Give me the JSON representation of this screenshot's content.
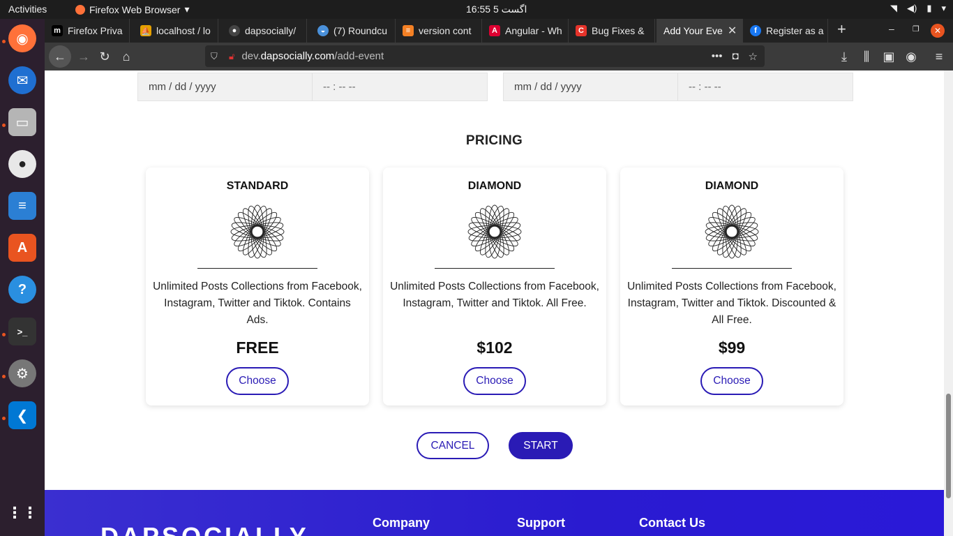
{
  "system": {
    "activities": "Activities",
    "app_name": "Firefox Web Browser",
    "clock": "16:55  اگست 5"
  },
  "tabs": [
    {
      "label": "Firefox Priva",
      "icon": "firefox-private-icon",
      "color": "#000000"
    },
    {
      "label": "localhost / lo",
      "icon": "phpmyadmin-icon",
      "color": "#e5a000"
    },
    {
      "label": "dapsocially/",
      "icon": "github-icon",
      "color": "#222222"
    },
    {
      "label": "(7) Roundcu",
      "icon": "roundcube-icon",
      "color": "#4a90d9"
    },
    {
      "label": "version cont",
      "icon": "stackoverflow-icon",
      "color": "#f48024"
    },
    {
      "label": "Angular - Wh",
      "icon": "angular-icon",
      "color": "#dd0031"
    },
    {
      "label": "Bug Fixes & ",
      "icon": "clickup-icon",
      "color": "#e6332a"
    },
    {
      "label": "Add Your Eve",
      "icon": "",
      "color": "",
      "active": true
    },
    {
      "label": "Register as a",
      "icon": "facebook-icon",
      "color": "#1877f2"
    }
  ],
  "url": {
    "prefix": "dev.",
    "domain": "dapsocially.com",
    "path": "/add-event"
  },
  "datetime": {
    "date_placeholder": "mm / dd / yyyy",
    "time_placeholder": "-- : --  --"
  },
  "pricing": {
    "title": "PRICING",
    "plans": [
      {
        "name": "STANDARD",
        "desc": "Unlimited Posts Collections from Facebook, Instagram, Twitter and Tiktok. Contains Ads.",
        "price": "FREE",
        "button": "Choose"
      },
      {
        "name": "DIAMOND",
        "desc": "Unlimited Posts Collections from Facebook, Instagram, Twitter and Tiktok. All Free.",
        "price": "$102",
        "button": "Choose"
      },
      {
        "name": "DIAMOND",
        "desc": "Unlimited Posts Collections from Facebook, Instagram, Twitter and Tiktok. Discounted & All Free.",
        "price": "$99",
        "button": "Choose"
      }
    ]
  },
  "actions": {
    "cancel": "CANCEL",
    "start": "START"
  },
  "footer": {
    "logo": "DAPSOCIALLY",
    "company": "Company",
    "support": "Support",
    "contact": "Contact Us"
  },
  "colors": {
    "brand": "#2a1bb5",
    "footer": "#2a1bd0"
  }
}
